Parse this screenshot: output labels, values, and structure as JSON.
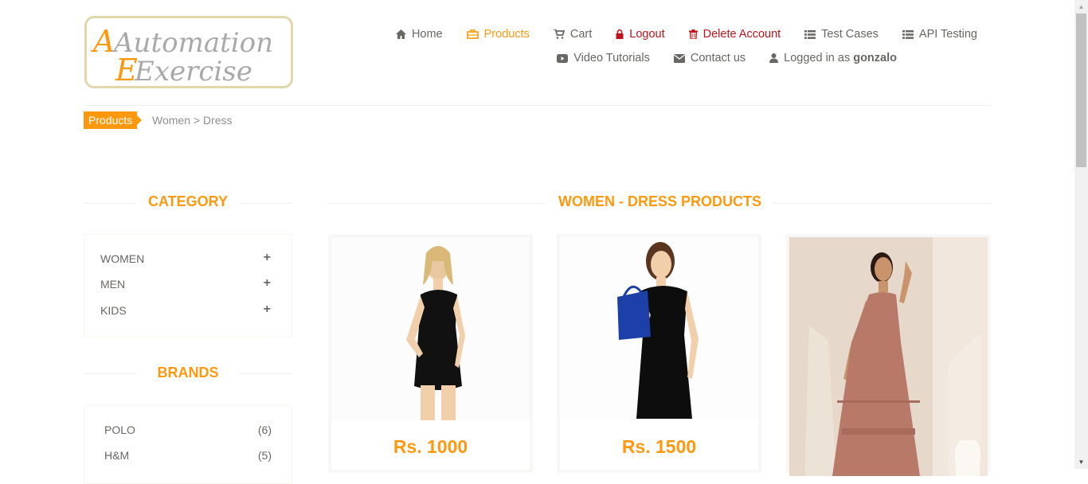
{
  "logo": {
    "line1": "Automation",
    "line2": "Exercise"
  },
  "nav": {
    "home": "Home",
    "products": "Products",
    "cart": "Cart",
    "logout": "Logout",
    "delete_account": "Delete Account",
    "test_cases": "Test Cases",
    "api_testing": "API Testing",
    "video_tutorials": "Video Tutorials",
    "contact_us": "Contact us",
    "logged_in_prefix": "Logged in as",
    "username": "gonzalo"
  },
  "breadcrumb": {
    "tag": "Products",
    "path": "Women > Dress"
  },
  "sidebar": {
    "category_title": "CATEGORY",
    "categories": [
      "WOMEN",
      "MEN",
      "KIDS"
    ],
    "brands_title": "BRANDS",
    "brands": [
      {
        "name": "POLO",
        "count": "(6)"
      },
      {
        "name": "H&M",
        "count": "(5)"
      }
    ]
  },
  "main": {
    "title": "WOMEN - DRESS PRODUCTS",
    "products": [
      {
        "price": "Rs. 1000"
      },
      {
        "price": "Rs. 1500"
      }
    ]
  },
  "colors": {
    "accent": "#fe980f",
    "danger": "#c0141a",
    "text": "#696763"
  }
}
